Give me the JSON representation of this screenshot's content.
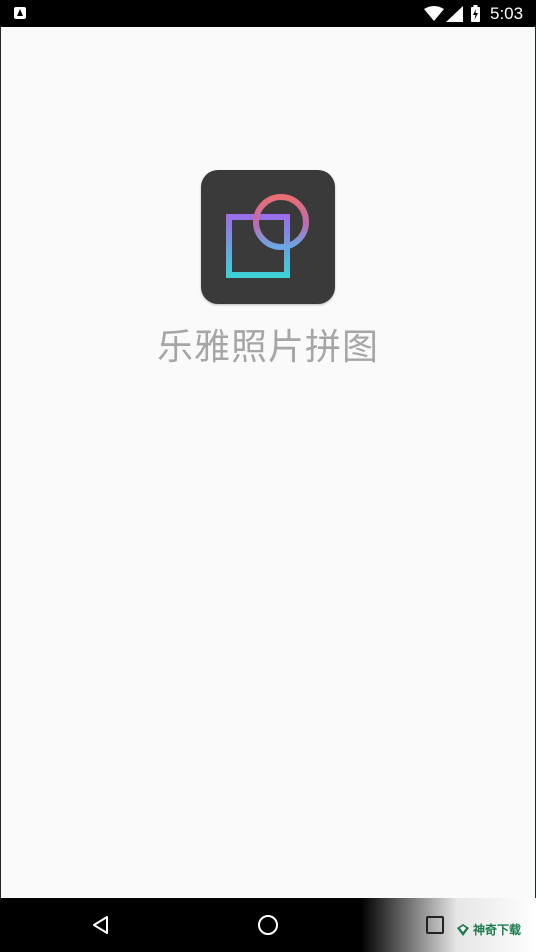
{
  "status_bar": {
    "time": "5:03",
    "icons": [
      "notification-a-icon",
      "wifi-icon",
      "cell-signal-icon",
      "battery-charging-icon"
    ]
  },
  "splash": {
    "app_name": "乐雅照片拼图",
    "icon": "overlapping-square-circle-logo",
    "icon_background": "#3a3a3a",
    "logo_gradient": [
      "#e96b72",
      "#8f6ee6",
      "#3fd0d6"
    ]
  },
  "nav_bar": {
    "buttons": [
      "back-icon",
      "home-icon",
      "recents-icon"
    ]
  },
  "watermark": {
    "text": "神奇下载"
  },
  "colors": {
    "background": "#fafafa",
    "app_name_text": "#a6a6a6",
    "watermark_text": "#1d7b4d"
  }
}
